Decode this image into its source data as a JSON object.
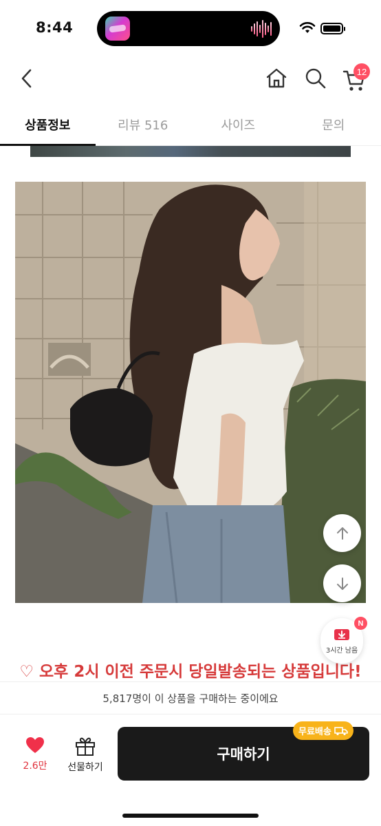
{
  "status_bar": {
    "time": "8:44"
  },
  "nav": {
    "cart_count": "12"
  },
  "tabs": [
    {
      "label": "상품정보",
      "active": true
    },
    {
      "label": "리뷰 516",
      "active": false
    },
    {
      "label": "사이즈",
      "active": false
    },
    {
      "label": "문의",
      "active": false
    }
  ],
  "content": {
    "notice": "♡ 오후 2시 이전 주문시 당일발송되는 상품입니다!"
  },
  "timer_widget": {
    "label": "3시간 남음",
    "badge": "N"
  },
  "buying_banner": {
    "text": "5,817명이 이 상품을 구매하는 중이에요"
  },
  "bottom_bar": {
    "like_count": "2.6만",
    "gift_label": "선물하기",
    "buy_label": "구매하기",
    "free_shipping_label": "무료배송"
  },
  "colors": {
    "accent_red": "#d63a3a",
    "badge_pink": "#ff4f63",
    "free_ship_yellow": "#f8b31a",
    "buy_button": "#1a1a1a"
  },
  "icons": [
    "back-icon",
    "home-icon",
    "search-icon",
    "cart-icon",
    "arrow-up-icon",
    "arrow-down-icon",
    "coupon-icon",
    "heart-icon",
    "gift-icon",
    "truck-icon"
  ]
}
